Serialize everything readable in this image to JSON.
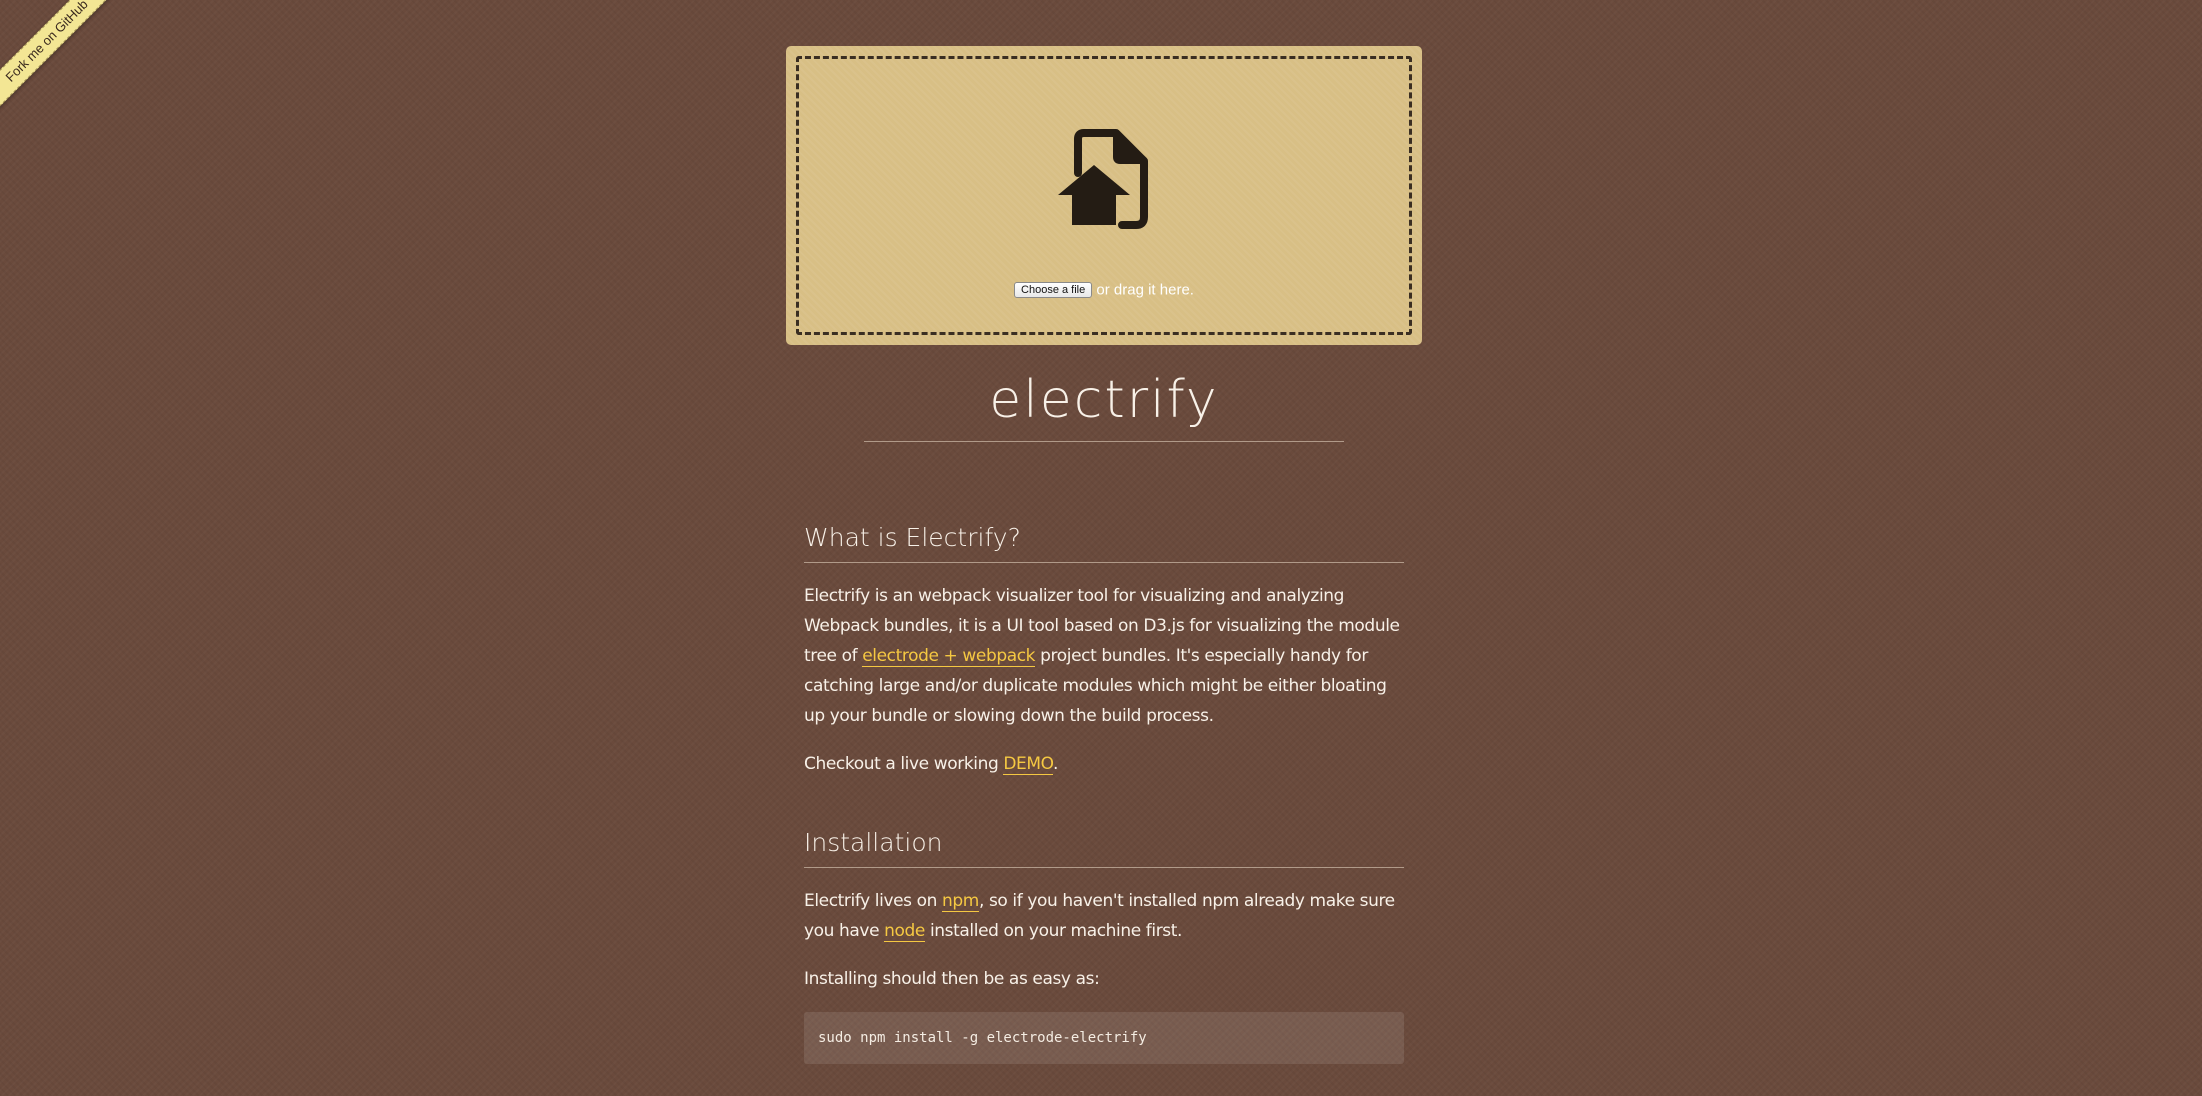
{
  "ribbon": {
    "label": "Fork me on GitHub"
  },
  "dropzone": {
    "button_label": "Choose a file",
    "drag_text": "or drag it here.",
    "icon": "file-upload-icon"
  },
  "site": {
    "title": "electrify"
  },
  "sections": {
    "what": {
      "heading": "What is Electrify?",
      "p1_before": "Electrify is an webpack visualizer tool for visualizing and analyzing Webpack bundles, it is a UI tool based on D3.js for visualizing the module tree of ",
      "p1_link": "electrode + webpack",
      "p1_after": " project bundles. It's especially handy for catching large and/or duplicate modules which might be either bloating up your bundle or slowing down the build process.",
      "p2_before": "Checkout a live working ",
      "p2_link": "DEMO",
      "p2_after": "."
    },
    "install": {
      "heading": "Installation",
      "p1_before": "Electrify lives on ",
      "p1_link1": "npm",
      "p1_middle": ", so if you haven't installed npm already make sure you have ",
      "p1_link2": "node",
      "p1_after": " installed on your machine first.",
      "p2": "Installing should then be as easy as:",
      "code": "sudo npm install -g electrode-electrify"
    }
  },
  "colors": {
    "background": "#6a4a3c",
    "dropzone": "#d8bf85",
    "link": "#f5c842",
    "ribbon": "#f3e694"
  }
}
